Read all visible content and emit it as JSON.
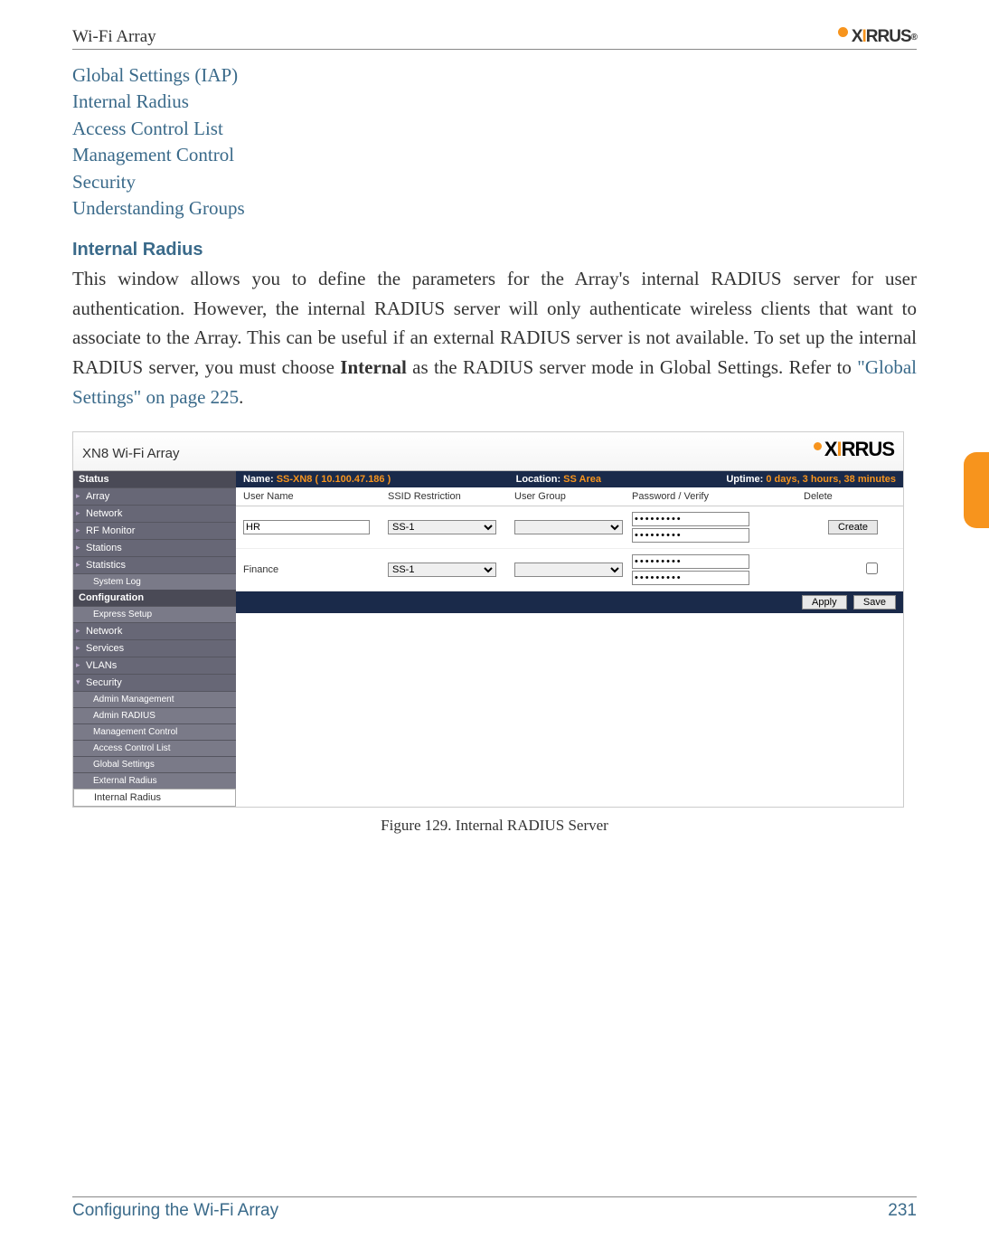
{
  "header": {
    "title": "Wi-Fi Array",
    "brand": "XIRRUS"
  },
  "see_also": [
    "Global Settings (IAP)",
    "Internal Radius",
    "Access Control List",
    "Management Control",
    "Security",
    "Understanding Groups"
  ],
  "section": {
    "heading": "Internal Radius",
    "para_pre": "This window allows you to define the parameters for the Array's internal RADIUS server for user authentication. However, the internal RADIUS server will only authenticate wireless clients that want to associate to the Array. This can be useful if an external RADIUS server is not available. To set up the internal RADIUS server, you must choose ",
    "para_bold": "Internal",
    "para_post": " as the RADIUS server mode in Global Settings. Refer to ",
    "para_link": "\"Global Settings\" on page 225",
    "para_end": "."
  },
  "app": {
    "title": "XN8 Wi-Fi Array",
    "brand": "XIRRUS",
    "status": {
      "name_label": "Name:",
      "name": "SS-XN8   ( 10.100.47.186 )",
      "location_label": "Location:",
      "location": "SS Area",
      "uptime_label": "Uptime:",
      "uptime": "0 days, 3 hours, 38 minutes"
    },
    "cols": {
      "user": "User Name",
      "ssid": "SSID Restriction",
      "group": "User Group",
      "pass": "Password   /   Verify",
      "del": "Delete"
    },
    "rows": [
      {
        "user": "HR",
        "ssid": "SS-1",
        "group": "",
        "pass": "•••••••••",
        "verify": "•••••••••",
        "action": "Create"
      },
      {
        "user": "Finance",
        "ssid": "SS-1",
        "group": "",
        "pass": "•••••••••",
        "verify": "•••••••••",
        "delete": true
      }
    ],
    "buttons": {
      "apply": "Apply",
      "save": "Save"
    },
    "sidebar": {
      "status_header": "Status",
      "status_items": [
        "Array",
        "Network",
        "RF Monitor",
        "Stations",
        "Statistics"
      ],
      "status_sub": "System Log",
      "config_header": "Configuration",
      "config_items_top": [
        "Express Setup",
        "Network",
        "Services",
        "VLANs"
      ],
      "security": "Security",
      "security_items": [
        "Admin Management",
        "Admin RADIUS",
        "Management Control",
        "Access Control List",
        "Global Settings",
        "External Radius"
      ],
      "active": "Internal Radius"
    }
  },
  "figure_caption": "Figure 129. Internal RADIUS Server",
  "footer": {
    "left": "Configuring the Wi-Fi Array",
    "right": "231"
  }
}
